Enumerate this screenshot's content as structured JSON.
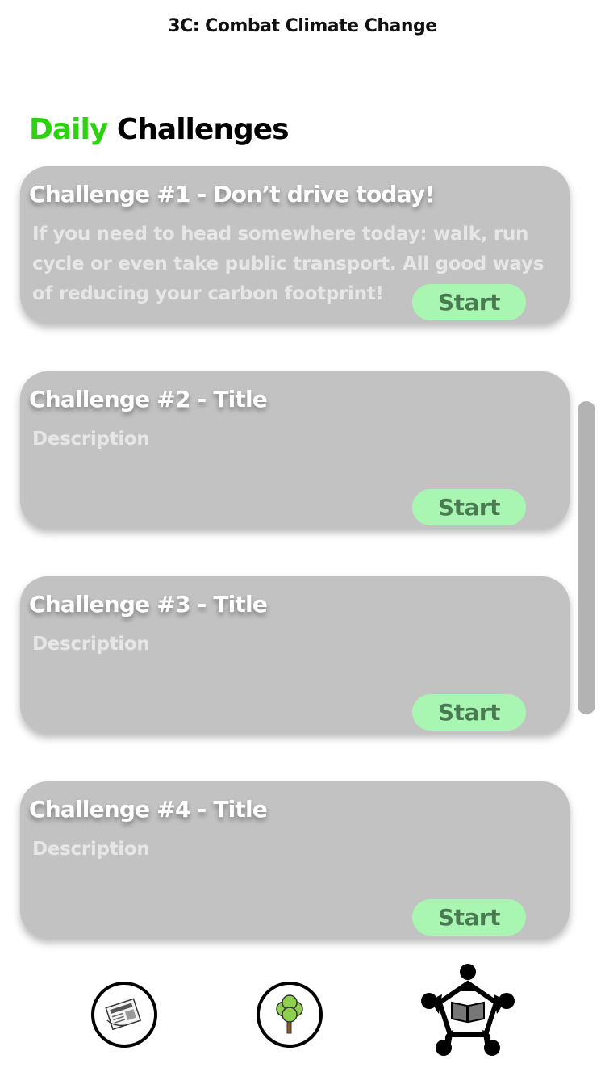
{
  "header": {
    "app_title": "3C: Combat Climate Change"
  },
  "section": {
    "accent_word": "Daily",
    "rest_word": "Challenges",
    "accent_color": "#2cd10f"
  },
  "challenges": [
    {
      "title": "Challenge #1 - Don’t drive today!",
      "description": "If you need to head somewhere today: walk, run cycle or even take public transport. All good ways of reducing your carbon footprint!",
      "button_label": "Start"
    },
    {
      "title": "Challenge #2 - Title",
      "description": "Description",
      "button_label": "Start"
    },
    {
      "title": "Challenge #3 - Title",
      "description": "Description",
      "button_label": "Start"
    },
    {
      "title": "Challenge #4 - Title",
      "description": "Description",
      "button_label": "Start"
    }
  ],
  "colors": {
    "card_bg": "#c2c2c2",
    "button_bg": "#a9f5b2",
    "button_text": "#4a7a52"
  },
  "bottom_nav": {
    "items": [
      {
        "icon": "newspaper-icon"
      },
      {
        "icon": "tree-icon"
      },
      {
        "icon": "community-book-icon"
      }
    ]
  }
}
